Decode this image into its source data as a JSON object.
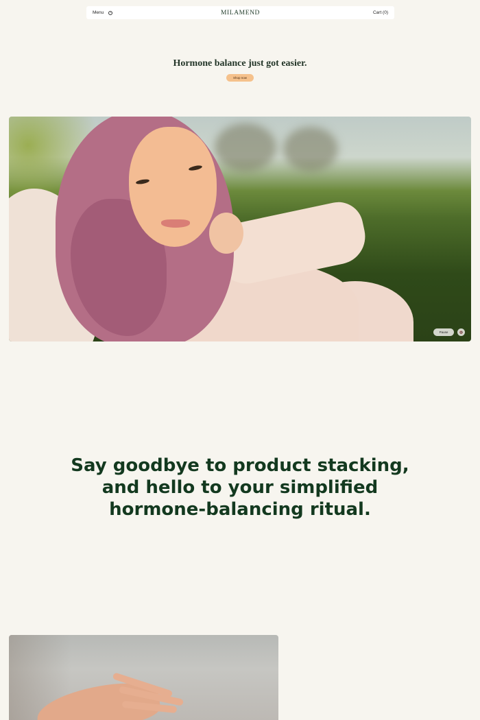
{
  "header": {
    "menu_label": "Menu",
    "account_icon": "account-icon",
    "logo": "MILAMEND",
    "cart_label": "Cart (0)"
  },
  "hero": {
    "title": "Hormone balance just got easier.",
    "cta_label": "Shop now"
  },
  "video": {
    "pause_label": "Pause",
    "mute_label": "🔇"
  },
  "statement": {
    "lines": [
      "Say goodbye to product stacking,",
      "and hello to your simplified",
      "hormone-balancing ritual."
    ]
  },
  "colors": {
    "background": "#f7f5ef",
    "accent": "#f5c18c",
    "brand_green": "#13391f"
  }
}
